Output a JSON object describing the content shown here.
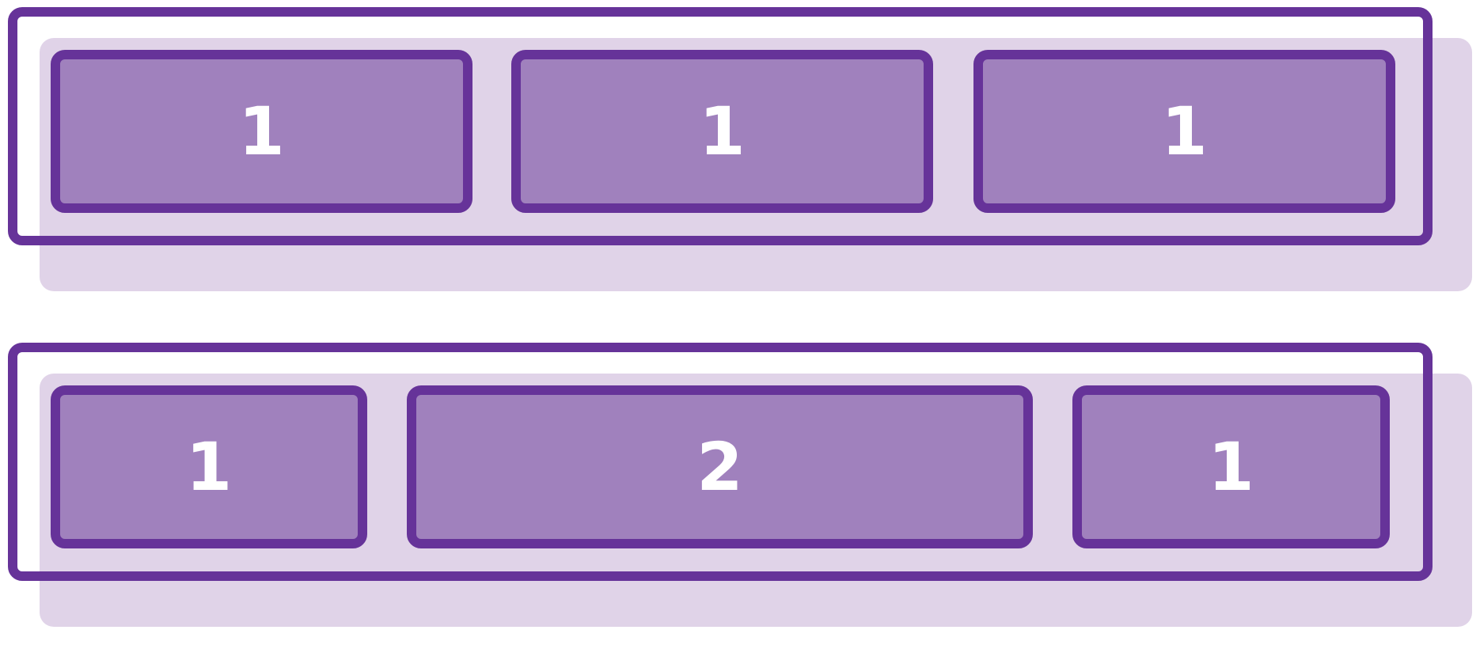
{
  "colors": {
    "accent": "#663399",
    "item_fill": "#a081bd",
    "shadow_fill": "#e0d3e8",
    "label": "#ffffff"
  },
  "rows": [
    {
      "items": [
        {
          "label": "1"
        },
        {
          "label": "1"
        },
        {
          "label": "1"
        }
      ]
    },
    {
      "items": [
        {
          "label": "1"
        },
        {
          "label": "2"
        },
        {
          "label": "1"
        }
      ]
    }
  ]
}
